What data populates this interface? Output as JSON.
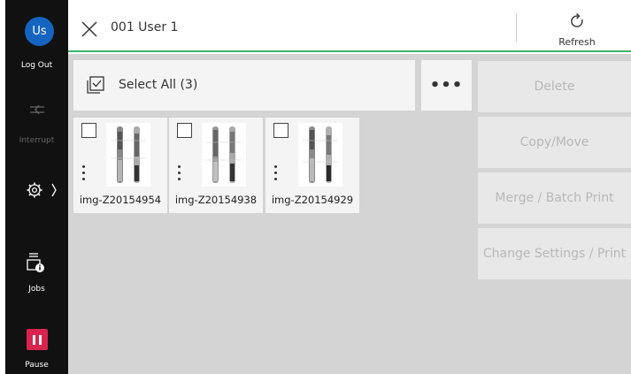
{
  "sidebar": {
    "avatar_initials": "Us",
    "logout_label": "Log Out",
    "interrupt_label": "Interrupt",
    "jobs_label": "Jobs",
    "pause_label": "Pause"
  },
  "header": {
    "title": "001 User 1",
    "refresh_label": "Refresh"
  },
  "selection": {
    "label": "Select All (3)",
    "more_label": "•••"
  },
  "files": [
    {
      "name": "img-Z20154954"
    },
    {
      "name": "img-Z20154938"
    },
    {
      "name": "img-Z20154929"
    }
  ],
  "actions": {
    "delete": "Delete",
    "copy_move": "Copy/Move",
    "merge": "Merge / Batch Print",
    "change_settings": "Change Settings / Print"
  },
  "colors": {
    "accent_green": "#3cb371",
    "avatar_blue": "#1565c0",
    "pause_red": "#d8244d"
  }
}
